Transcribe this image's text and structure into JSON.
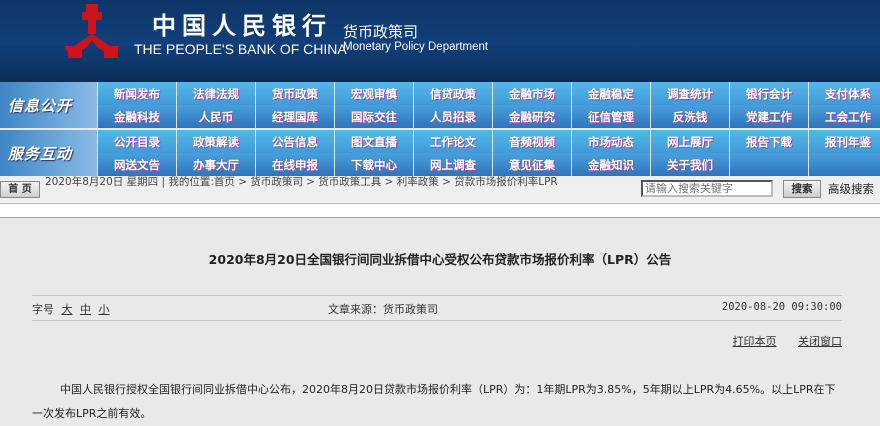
{
  "header": {
    "bank_cn": "中国人民银行",
    "bank_en": "THE PEOPLE'S BANK OF CHINA",
    "dept_cn": "货币政策司",
    "dept_en": "Monetary Policy Department"
  },
  "nav": [
    {
      "label": "信息公开",
      "rows": [
        [
          "新闻发布",
          "法律法规",
          "货币政策",
          "宏观审慎",
          "信贷政策",
          "金融市场",
          "金融稳定",
          "调查统计",
          "银行会计",
          "支付体系"
        ],
        [
          "金融科技",
          "人民币",
          "经理国库",
          "国际交往",
          "人员招录",
          "金融研究",
          "征信管理",
          "反洗钱",
          "党建工作",
          "工会工作"
        ]
      ]
    },
    {
      "label": "服务互动",
      "rows": [
        [
          "公开目录",
          "政策解读",
          "公告信息",
          "图文直播",
          "工作论文",
          "音频视频",
          "市场动态",
          "网上展厅",
          "报告下载",
          "报刊年鉴"
        ],
        [
          "网送文告",
          "办事大厅",
          "在线申报",
          "下载中心",
          "网上调查",
          "意见征集",
          "金融知识",
          "关于我们",
          "",
          ""
        ]
      ]
    }
  ],
  "breadcrumb": {
    "home": "首 页",
    "text": "2020年8月20日 星期四 | 我的位置:首页 > 货币政策司 > 货币政策工具 > 利率政策 > 贷款市场报价利率LPR"
  },
  "search": {
    "placeholder": "请输入搜索关键字",
    "button": "搜索",
    "advanced": "高级搜索"
  },
  "article": {
    "title": "2020年8月20日全国银行间同业拆借中心受权公布贷款市场报价利率（LPR）公告",
    "font_label": "字号",
    "font_large": "大",
    "font_medium": "中",
    "font_small": "小",
    "source": "文章来源：货币政策司",
    "datetime": "2020-08-20 09:30:00",
    "print": "打印本页",
    "close": "关闭窗口",
    "body": "中国人民银行授权全国银行间同业拆借中心公布，2020年8月20日贷款市场报价利率（LPR）为：1年期LPR为3.85%，5年期以上LPR为4.65%。以上LPR在下一次发布LPR之前有效。"
  }
}
